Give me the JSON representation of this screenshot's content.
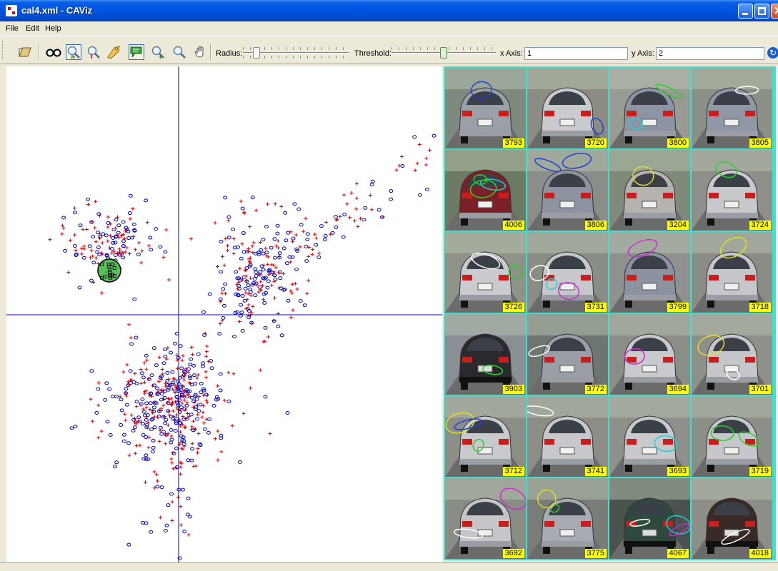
{
  "window": {
    "title": "cal4.xml - CAViz"
  },
  "menu": {
    "items": [
      "File",
      "Edit",
      "Help"
    ]
  },
  "toolbar": {
    "icons": [
      "folder-open-icon",
      "glasses-icon",
      "zoom-w-icon",
      "zoom-l-icon",
      "tag-icon",
      "comment-icon",
      "zoom-in-icon",
      "zoom-out-icon",
      "hand-icon"
    ],
    "radius_label": "Radius:",
    "threshold_label": "Threshold:",
    "radius_value": 0.1,
    "threshold_value": 0.5,
    "x_axis_label": "x Axis:",
    "x_axis_value": "1",
    "y_axis_label": "y Axis:",
    "y_axis_value": "2"
  },
  "colors": {
    "plus_marker": "#e00000",
    "circle_marker": "#0000c8",
    "axis_line": "#0000c8",
    "thumb_border": "#40e0d0",
    "thumb_label_bg": "#ffff00"
  },
  "thumbnails": [
    {
      "id": "3793",
      "car": "#9aa0a8",
      "bg": "#7e8a80"
    },
    {
      "id": "3720",
      "car": "#c9cbcf",
      "bg": "#8c8c84"
    },
    {
      "id": "3800",
      "car": "#8d94a4",
      "bg": "#9a9a94"
    },
    {
      "id": "3805",
      "car": "#9097a6",
      "bg": "#8a9086"
    },
    {
      "id": "4006",
      "car": "#7c2028",
      "bg": "#6d7a66"
    },
    {
      "id": "3806",
      "car": "#8e93a0",
      "bg": "#8a8d88"
    },
    {
      "id": "3204",
      "car": "#b6b2ad",
      "bg": "#7f8a7a"
    },
    {
      "id": "3724",
      "car": "#c7c9cc",
      "bg": "#8d8f88"
    },
    {
      "id": "3726",
      "car": "#c9cbce",
      "bg": "#8f9289"
    },
    {
      "id": "3731",
      "car": "#c6c8cb",
      "bg": "#8a8c86"
    },
    {
      "id": "3799",
      "car": "#8c92a0",
      "bg": "#8f9190"
    },
    {
      "id": "3718",
      "car": "#c5c7ca",
      "bg": "#8b8c86"
    },
    {
      "id": "3903",
      "car": "#2a2a2e",
      "bg": "#8a8f96"
    },
    {
      "id": "3772",
      "car": "#9a9ea6",
      "bg": "#6f7672"
    },
    {
      "id": "3694",
      "car": "#c8cacd",
      "bg": "#8b8d87"
    },
    {
      "id": "3701",
      "car": "#c5c7ca",
      "bg": "#8e908a"
    },
    {
      "id": "3712",
      "car": "#c8cacd",
      "bg": "#8c8e88"
    },
    {
      "id": "3741",
      "car": "#c6c8cb",
      "bg": "#8b8d86"
    },
    {
      "id": "3693",
      "car": "#c7c9cc",
      "bg": "#8e908a"
    },
    {
      "id": "3719",
      "car": "#c5c7ca",
      "bg": "#8c8e88"
    },
    {
      "id": "3692",
      "car": "#c4c6c9",
      "bg": "#8a8c86"
    },
    {
      "id": "3775",
      "car": "#a8acb2",
      "bg": "#7a7c78"
    },
    {
      "id": "4067",
      "car": "#2e4a3e",
      "bg": "#4c5250"
    },
    {
      "id": "4018",
      "car": "#3a2a26",
      "bg": "#8c8e88"
    }
  ]
}
